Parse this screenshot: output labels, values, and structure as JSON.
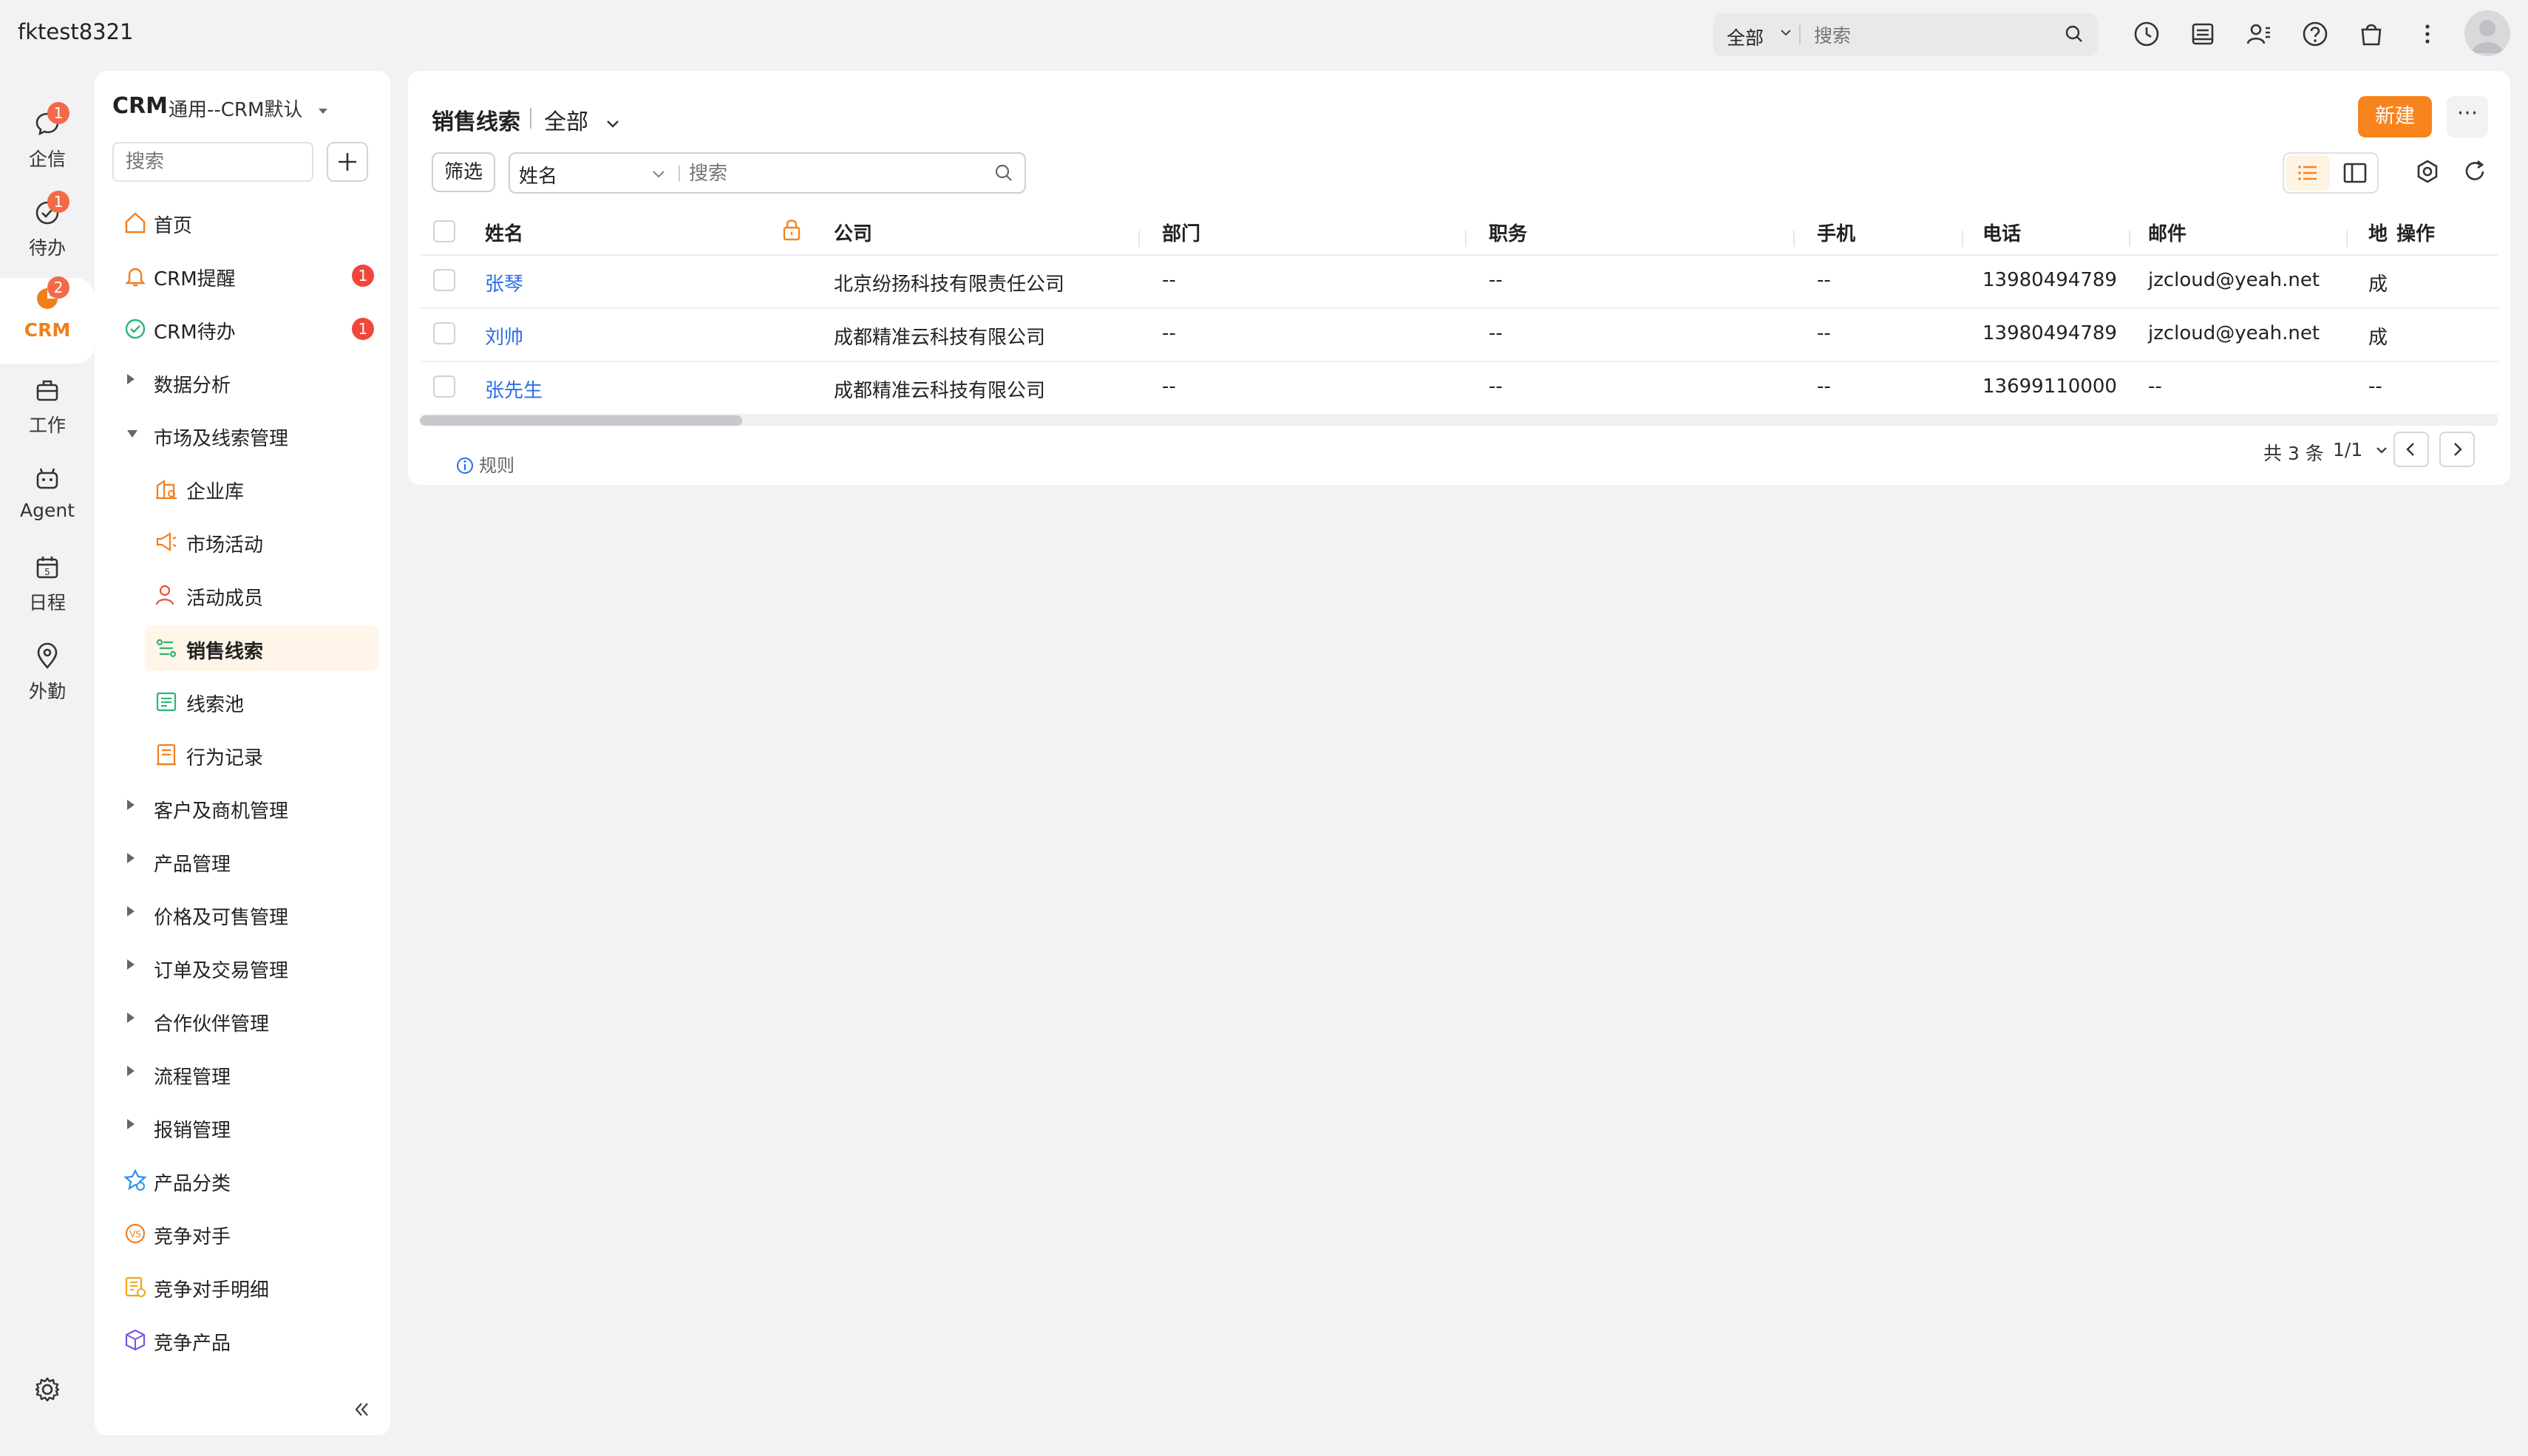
{
  "topbar": {
    "tenant": "fktest8321",
    "search_scope": "全部",
    "search_placeholder": "搜索"
  },
  "rail": [
    {
      "label": "企信",
      "badge": "1",
      "icon": "chat-bubble-icon"
    },
    {
      "label": "待办",
      "badge": "1",
      "icon": "check-circle-icon"
    },
    {
      "label": "CRM",
      "badge": "2",
      "icon": "pie-chart-icon",
      "active": true
    },
    {
      "label": "工作",
      "badge": "",
      "icon": "briefcase-icon"
    },
    {
      "label": "Agent",
      "badge": "",
      "icon": "robot-icon"
    },
    {
      "label": "日程",
      "badge": "",
      "icon": "calendar-icon"
    },
    {
      "label": "外勤",
      "badge": "",
      "icon": "location-pin-icon"
    }
  ],
  "nav": {
    "title": "CRM",
    "subtitle": "通用--CRM默认",
    "search_placeholder": "搜索",
    "items": [
      {
        "label": "首页",
        "icon": "home-icon",
        "kind": "top"
      },
      {
        "label": "CRM提醒",
        "icon": "bell-icon",
        "kind": "top",
        "badge": "1"
      },
      {
        "label": "CRM待办",
        "icon": "todo-check-icon",
        "kind": "top",
        "badge": "1"
      },
      {
        "label": "数据分析",
        "kind": "group"
      },
      {
        "label": "市场及线索管理",
        "kind": "group-open"
      },
      {
        "label": "企业库",
        "icon": "enterprise-icon",
        "kind": "child"
      },
      {
        "label": "市场活动",
        "icon": "megaphone-icon",
        "kind": "child"
      },
      {
        "label": "活动成员",
        "icon": "member-icon",
        "kind": "child"
      },
      {
        "label": "销售线索",
        "icon": "sales-lead-icon",
        "kind": "child",
        "active": true
      },
      {
        "label": "线索池",
        "icon": "lead-pool-icon",
        "kind": "child"
      },
      {
        "label": "行为记录",
        "icon": "behavior-record-icon",
        "kind": "child"
      },
      {
        "label": "客户及商机管理",
        "kind": "group"
      },
      {
        "label": "产品管理",
        "kind": "group"
      },
      {
        "label": "价格及可售管理",
        "kind": "group"
      },
      {
        "label": "订单及交易管理",
        "kind": "group"
      },
      {
        "label": "合作伙伴管理",
        "kind": "group"
      },
      {
        "label": "流程管理",
        "kind": "group"
      },
      {
        "label": "报销管理",
        "kind": "group"
      },
      {
        "label": "产品分类",
        "icon": "product-category-icon",
        "kind": "top"
      },
      {
        "label": "竞争对手",
        "icon": "vs-icon",
        "kind": "top"
      },
      {
        "label": "竞争对手明细",
        "icon": "competitor-detail-icon",
        "kind": "top"
      },
      {
        "label": "竞争产品",
        "icon": "competitor-product-icon",
        "kind": "top"
      }
    ]
  },
  "main": {
    "title": "销售线索",
    "view_scope": "全部",
    "new_button": "新建",
    "more_button": "···",
    "filter_button": "筛选",
    "filter_field": "姓名",
    "filter_placeholder": "搜索",
    "columns": [
      "姓名",
      "公司",
      "部门",
      "职务",
      "手机",
      "电话",
      "邮件",
      "地",
      "操作"
    ],
    "rows": [
      {
        "name": "张琴",
        "company": "北京纷扬科技有限责任公司",
        "dept": "--",
        "title": "--",
        "mobile": "--",
        "phone": "13980494789",
        "email": "jzcloud@yeah.net",
        "addr": "成"
      },
      {
        "name": "刘帅",
        "company": "成都精准云科技有限公司",
        "dept": "--",
        "title": "--",
        "mobile": "--",
        "phone": "13980494789",
        "email": "jzcloud@yeah.net",
        "addr": "成"
      },
      {
        "name": "张先生",
        "company": "成都精准云科技有限公司",
        "dept": "--",
        "title": "--",
        "mobile": "--",
        "phone": "13699110000",
        "email": "--",
        "addr": "--"
      }
    ],
    "rules_link": "规则",
    "pager_total": "共 3 条",
    "pager_page": "1/1"
  },
  "colors": {
    "accent": "#f7841f",
    "link": "#2a6ee8",
    "badge": "#f0463c"
  }
}
